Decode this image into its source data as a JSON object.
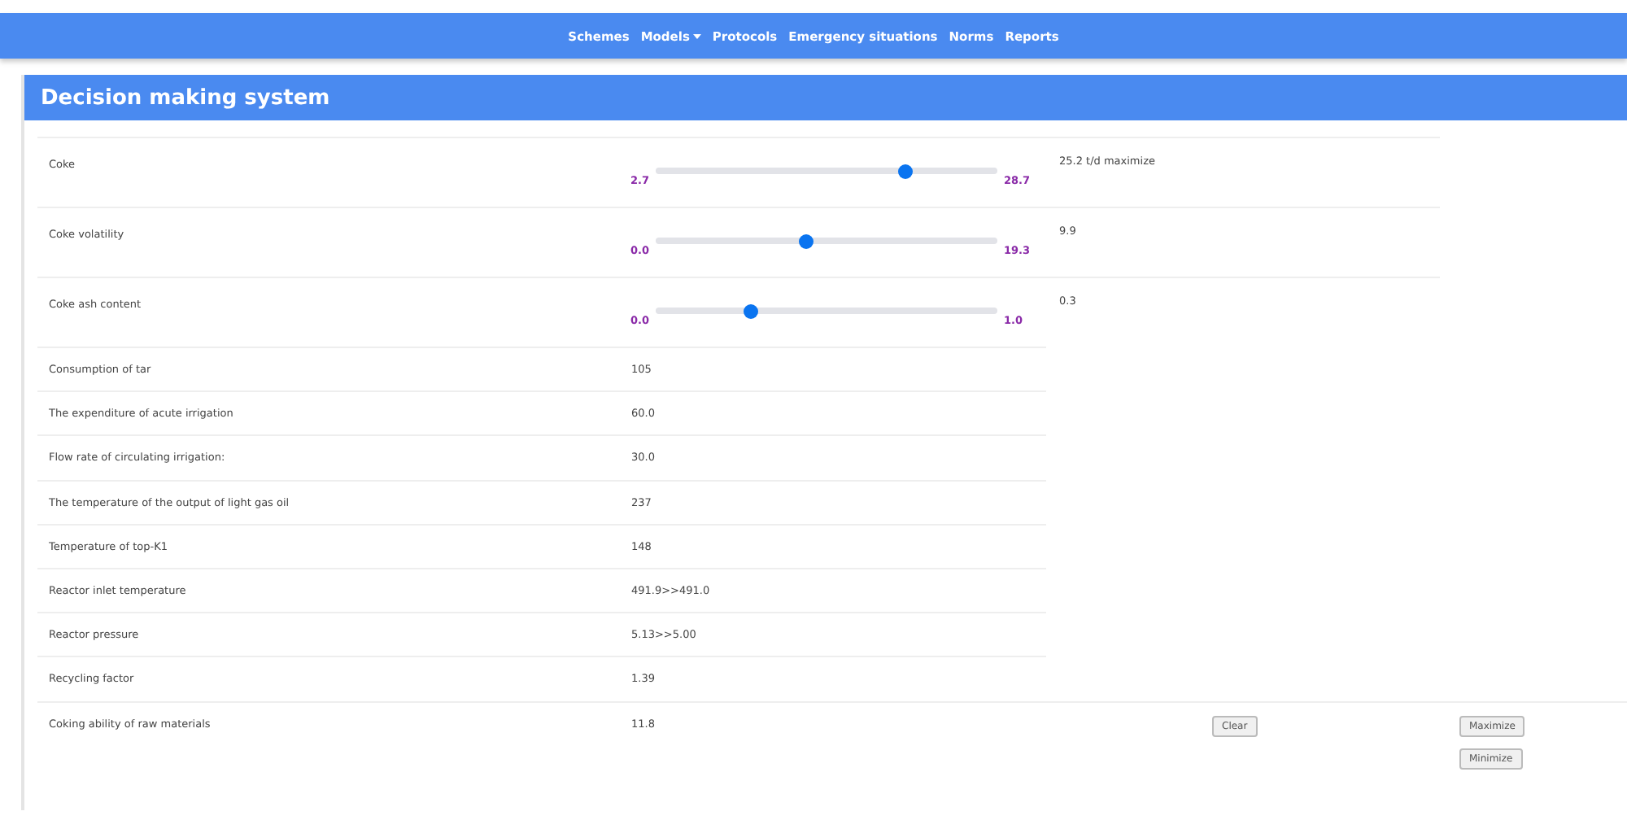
{
  "nav": {
    "items": [
      {
        "label": "Schemes",
        "dropdown": false
      },
      {
        "label": "Models",
        "dropdown": true
      },
      {
        "label": "Protocols",
        "dropdown": false
      },
      {
        "label": "Emergency situations",
        "dropdown": false
      },
      {
        "label": "Norms",
        "dropdown": false
      },
      {
        "label": "Reports",
        "dropdown": false
      }
    ]
  },
  "panel": {
    "title": "Decision making system"
  },
  "sliders": [
    {
      "label": "Coke",
      "min": "2.7",
      "max": "28.7",
      "level": 0.73,
      "reading": "25.2 t/d maximize"
    },
    {
      "label": "Coke volatility",
      "min": "0.0",
      "max": "19.3",
      "level": 0.44,
      "reading": "9.9"
    },
    {
      "label": "Coke ash content",
      "min": "0.0",
      "max": "1.0",
      "level": 0.28,
      "reading": "0.3"
    }
  ],
  "rows": [
    {
      "label": "Consumption of tar",
      "value": "105"
    },
    {
      "label": "The expenditure of acute irrigation",
      "value": "60.0"
    },
    {
      "label": "Flow rate of circulating irrigation:",
      "value": "30.0"
    },
    {
      "label": "The temperature of the output of light gas oil",
      "value": "237"
    },
    {
      "label": "Temperature of top-K1",
      "value": "148"
    },
    {
      "label": "Reactor inlet temperature",
      "value": "491.9>>491.0"
    },
    {
      "label": "Reactor pressure",
      "value": "5.13>>5.00"
    },
    {
      "label": "Recycling factor",
      "value": "1.39"
    }
  ],
  "last_row": {
    "label": "Coking ability of raw materials",
    "value": "11.8"
  },
  "buttons": {
    "clear": "Clear",
    "maximize": "Maximize",
    "minimize": "Minimize"
  }
}
